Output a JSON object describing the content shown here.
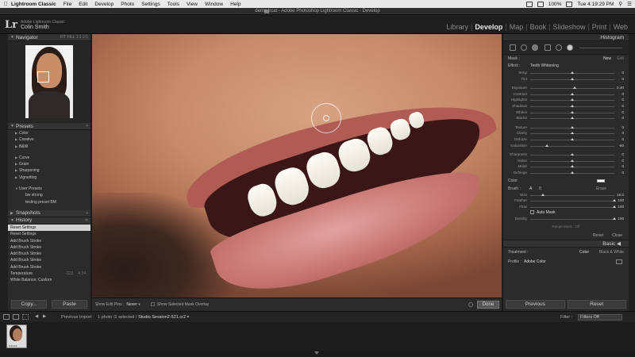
{
  "menubar": {
    "items": [
      "Lightroom Classic",
      "File",
      "Edit",
      "Develop",
      "Photo",
      "Settings",
      "Tools",
      "View",
      "Window",
      "Help"
    ],
    "status": "100%",
    "clock": "Tue 4:19:29 PM"
  },
  "window": {
    "title": "demo.lrcat - Adobe Photoshop Lightroom Classic - Develop"
  },
  "identity": {
    "logo": "Lr",
    "line1": "Adobe Lightroom Classic",
    "user": "Colin Smith"
  },
  "modules": [
    "Library",
    "Develop",
    "Map",
    "Book",
    "Slideshow",
    "Print",
    "Web"
  ],
  "active_module": "Develop",
  "left": {
    "navigator_title": "Navigator",
    "navigator_zoom": "FIT  FILL  1:1  2:1",
    "presets_title": "Presets",
    "presets_groups": [
      "Color",
      "Creative",
      "B&W"
    ],
    "presets_groups2": [
      "Curve",
      "Grain",
      "Sharpening",
      "Vignetting"
    ],
    "user_presets": "User Presets",
    "user_preset_items": [
      "bw strong",
      "testing preset BM"
    ],
    "snapshots_title": "Snapshots",
    "history_title": "History",
    "history": [
      {
        "label": "Reset Settings",
        "v1": "",
        "v2": ""
      },
      {
        "label": "Reset Settings",
        "v1": "",
        "v2": ""
      },
      {
        "label": "Add Brush Stroke",
        "v1": "",
        "v2": ""
      },
      {
        "label": "Add Brush Stroke",
        "v1": "",
        "v2": ""
      },
      {
        "label": "Add Brush Stroke",
        "v1": "",
        "v2": ""
      },
      {
        "label": "Add Brush Stroke",
        "v1": "",
        "v2": ""
      },
      {
        "label": "Add Brush Stroke",
        "v1": "",
        "v2": ""
      },
      {
        "label": "Temperature",
        "v1": "-123",
        "v2": "4.74"
      },
      {
        "label": "White Balance: Custom",
        "v1": "",
        "v2": ""
      }
    ],
    "copy_btn": "Copy...",
    "paste_btn": "Paste"
  },
  "toolbar": {
    "pins_label": "Show Edit Pins :",
    "pins_value": "Never",
    "overlay_label": "Show Selected Mask Overlay",
    "done": "Done"
  },
  "right": {
    "histogram_title": "Histogram",
    "mask_label": "Mask :",
    "mask_new": "New",
    "mask_edit": "Edit",
    "effect_label": "Effect :",
    "effect_value": "Teeth Whitening",
    "sliders1": [
      {
        "label": "Temp",
        "val": "0",
        "pos": 0.5
      },
      {
        "label": "Tint",
        "val": "0",
        "pos": 0.5
      }
    ],
    "sliders2": [
      {
        "label": "Exposure",
        "val": "0.40",
        "pos": 0.53
      },
      {
        "label": "Contrast",
        "val": "0",
        "pos": 0.5
      },
      {
        "label": "Highlights",
        "val": "0",
        "pos": 0.5
      },
      {
        "label": "Shadows",
        "val": "0",
        "pos": 0.5
      },
      {
        "label": "Whites",
        "val": "0",
        "pos": 0.5
      },
      {
        "label": "Blacks",
        "val": "0",
        "pos": 0.5
      }
    ],
    "sliders3": [
      {
        "label": "Texture",
        "val": "0",
        "pos": 0.5
      },
      {
        "label": "Clarity",
        "val": "0",
        "pos": 0.5
      },
      {
        "label": "Dehaze",
        "val": "0",
        "pos": 0.5
      },
      {
        "label": "Saturation",
        "val": "-60",
        "pos": 0.2
      }
    ],
    "sliders4": [
      {
        "label": "Sharpness",
        "val": "0",
        "pos": 0.5
      },
      {
        "label": "Noise",
        "val": "0",
        "pos": 0.5
      },
      {
        "label": "Moiré",
        "val": "0",
        "pos": 0.5
      },
      {
        "label": "Defringe",
        "val": "0",
        "pos": 0.5
      }
    ],
    "color_label": "Color",
    "brush_label": "Brush :",
    "brush_a": "A",
    "brush_b": "B",
    "brush_erase": "Erase",
    "brush_sliders": [
      {
        "label": "Size",
        "val": "16.0",
        "pos": 0.15
      },
      {
        "label": "Feather",
        "val": "100",
        "pos": 1.0
      },
      {
        "label": "Flow",
        "val": "100",
        "pos": 1.0
      }
    ],
    "auto_mask": "Auto Mask",
    "density": {
      "label": "Density",
      "val": "100",
      "pos": 1.0
    },
    "range_mask": "Range Mask : Off",
    "reset": "Reset",
    "close": "Close",
    "basic": "Basic",
    "treatment_label": "Treatment :",
    "treatment_color": "Color",
    "treatment_bw": "Black & White",
    "profile_label": "Profile :",
    "profile_value": "Adobe Color",
    "previous_btn": "Previous",
    "reset_btn": "Reset"
  },
  "filmstrip": {
    "source": "Previous Import",
    "count": "1 photo /1 selected /",
    "filename": "Studio Session2-521.cr2",
    "filter_label": "Filter :",
    "filter_value": "Filters Off"
  }
}
